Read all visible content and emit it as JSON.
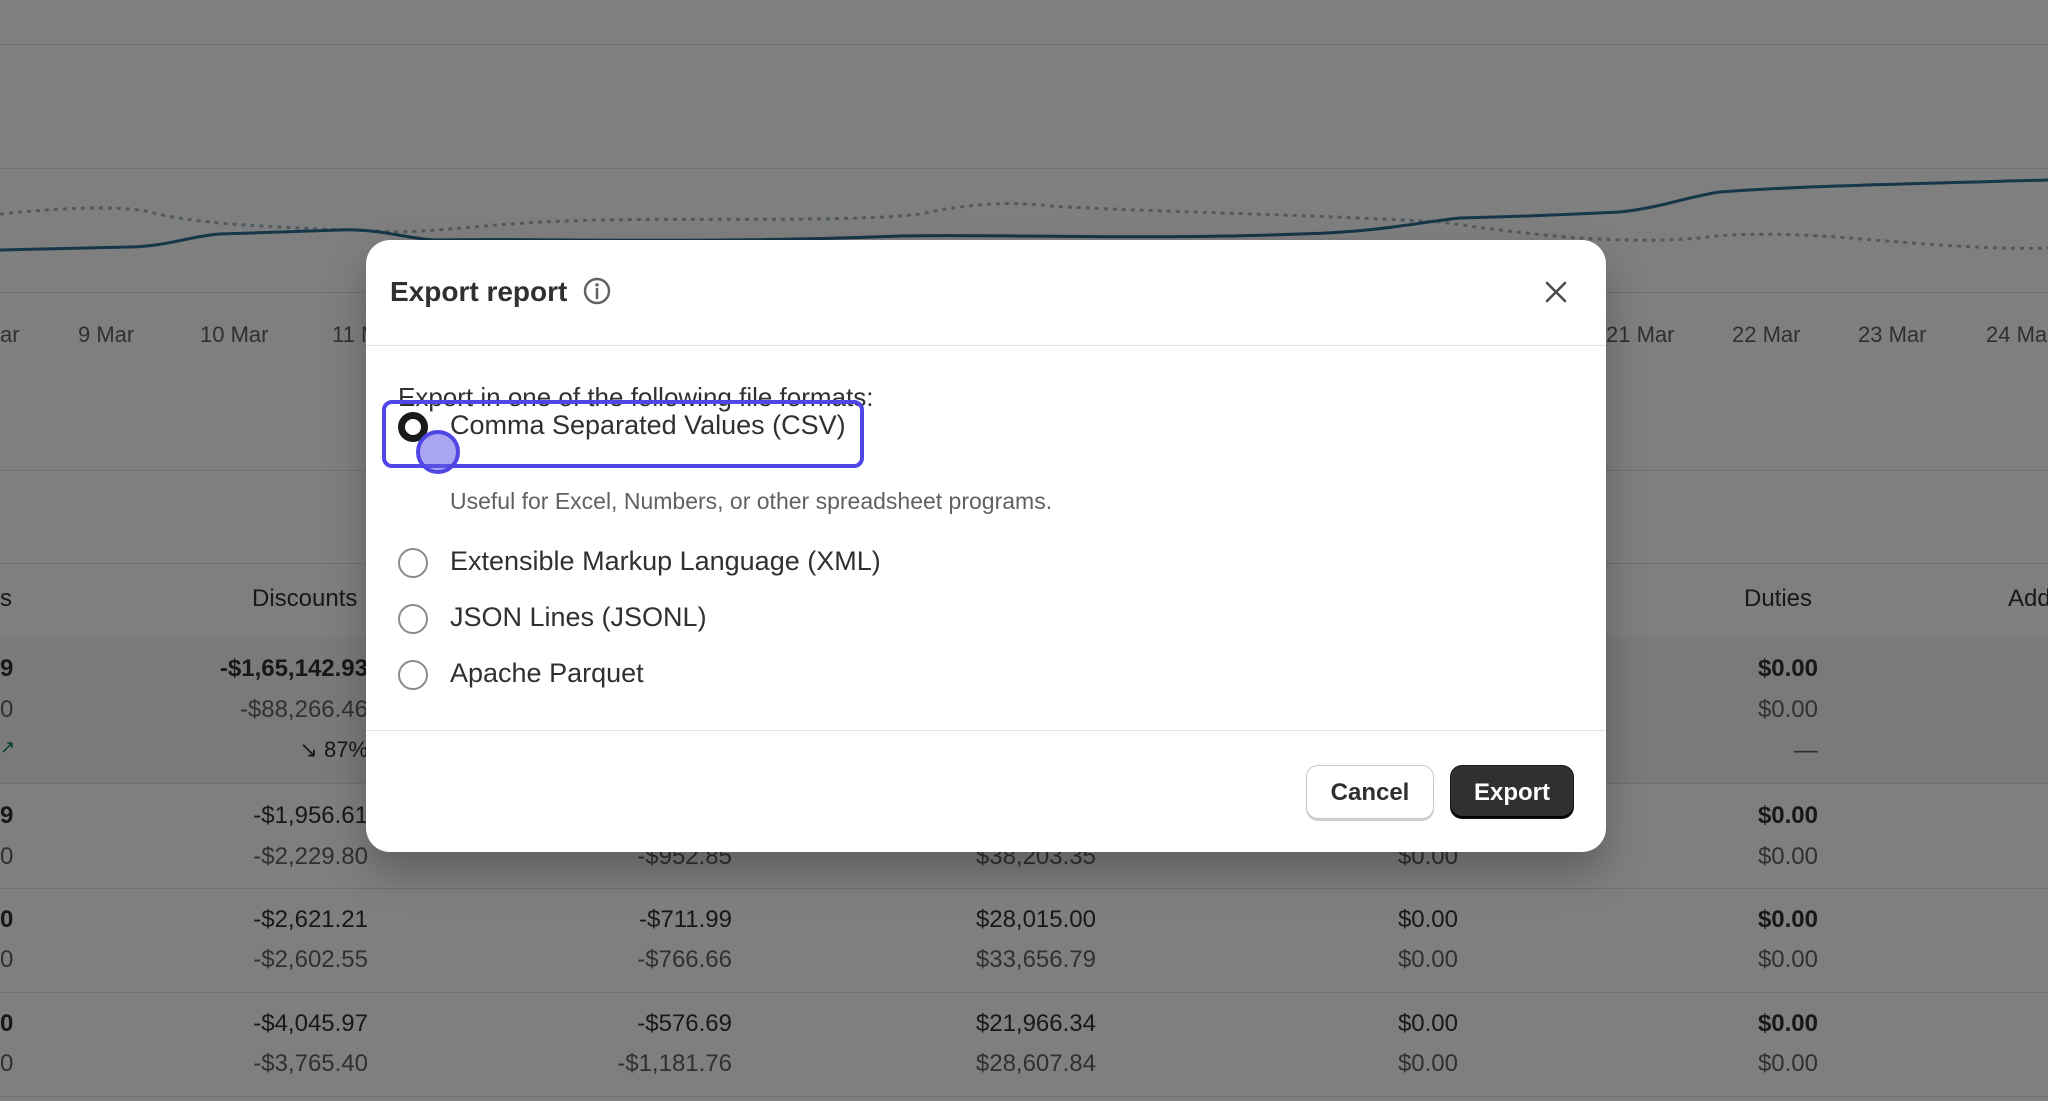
{
  "background": {
    "chart": {
      "x_tick_labels": [
        "ar",
        "9 Mar",
        "10 Mar",
        "11 M",
        "21 Mar",
        "22 Mar",
        "23 Mar",
        "24 Ma"
      ],
      "series_colors": {
        "current": "#2c6e8f",
        "comparison": "#9fb7c4"
      }
    },
    "table": {
      "headers": [
        "s",
        "Discounts",
        "Duties",
        "Add"
      ],
      "summary": {
        "col0": [
          "9",
          "0",
          "↗"
        ],
        "discounts": [
          "-$1,65,142.93",
          "-$88,266.46",
          "↘ 87%"
        ],
        "duties": [
          "$0.00",
          "$0.00",
          "—"
        ]
      },
      "rows": [
        {
          "col0": [
            "9",
            "0"
          ],
          "discounts": [
            "-$1,956.61",
            "-$2,229.80"
          ],
          "col_c": [
            "",
            "-$952.85"
          ],
          "col_d": [
            "",
            "$38,203.35"
          ],
          "col_e": [
            "",
            "$0.00"
          ],
          "duties": [
            "$0.00",
            "$0.00"
          ]
        },
        {
          "col0": [
            "0",
            "0"
          ],
          "discounts": [
            "-$2,621.21",
            "-$2,602.55"
          ],
          "col_c": [
            "-$711.99",
            "-$766.66"
          ],
          "col_d": [
            "$28,015.00",
            "$33,656.79"
          ],
          "col_e": [
            "$0.00",
            "$0.00"
          ],
          "duties": [
            "$0.00",
            "$0.00"
          ]
        },
        {
          "col0": [
            "0",
            "0"
          ],
          "discounts": [
            "-$4,045.97",
            "-$3,765.40"
          ],
          "col_c": [
            "-$576.69",
            "-$1,181.76"
          ],
          "col_d": [
            "$21,966.34",
            "$28,607.84"
          ],
          "col_e": [
            "$0.00",
            "$0.00"
          ],
          "duties": [
            "$0.00",
            "$0.00"
          ]
        }
      ]
    }
  },
  "modal": {
    "title": "Export report",
    "info_icon": "info-icon",
    "close_icon": "close-icon",
    "lead": "Export in one of the following file formats:",
    "options": [
      {
        "label": "Comma Separated Values (CSV)",
        "help": "Useful for Excel, Numbers, or other spreadsheet programs.",
        "checked": true
      },
      {
        "label": "Extensible Markup Language (XML)",
        "checked": false
      },
      {
        "label": "JSON Lines (JSONL)",
        "checked": false
      },
      {
        "label": "Apache Parquet",
        "checked": false
      }
    ],
    "cancel_label": "Cancel",
    "export_label": "Export",
    "accent_color": "#4f46e5"
  }
}
